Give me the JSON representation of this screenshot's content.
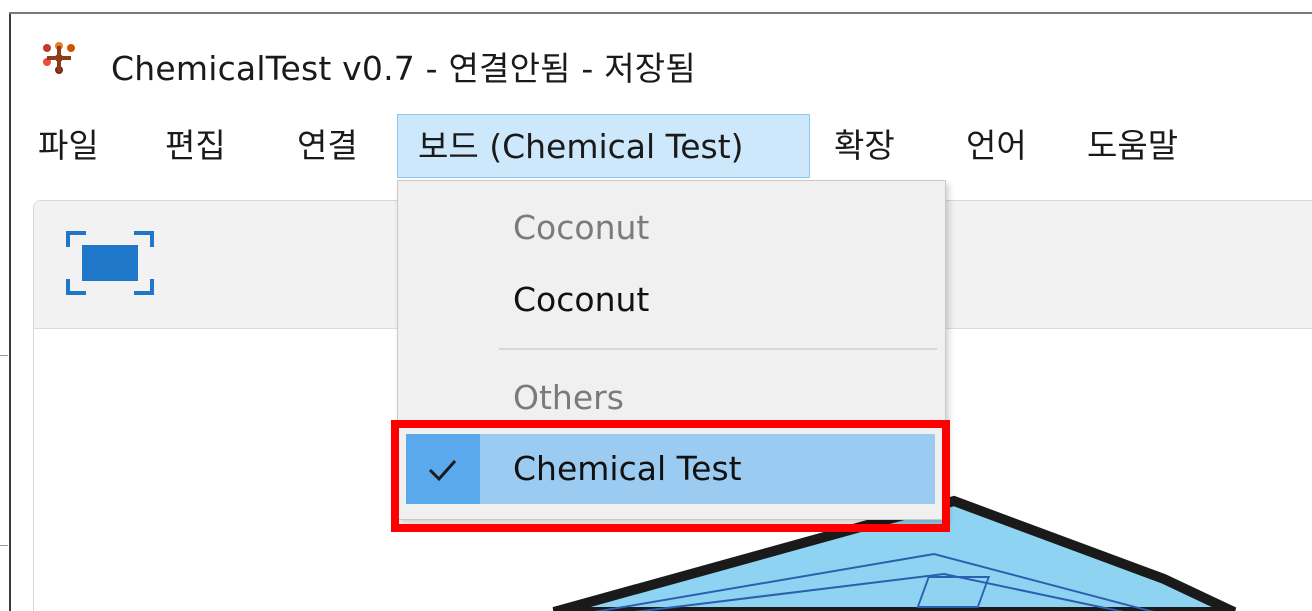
{
  "window": {
    "title": "ChemicalTest v0.7 - 연결안됨 - 저장됨"
  },
  "menu": {
    "items": [
      {
        "id": "file",
        "label": "파일"
      },
      {
        "id": "edit",
        "label": "편집"
      },
      {
        "id": "connect",
        "label": "연결"
      },
      {
        "id": "board",
        "label": "보드 (Chemical Test)",
        "active": true
      },
      {
        "id": "extensions",
        "label": "확장"
      },
      {
        "id": "language",
        "label": "언어"
      },
      {
        "id": "help",
        "label": "도움말"
      }
    ]
  },
  "board_menu": {
    "sections": [
      {
        "header": "Coconut",
        "options": [
          {
            "label": "Coconut",
            "checked": false
          }
        ]
      },
      {
        "header": "Others",
        "options": [
          {
            "label": "Chemical Test",
            "checked": true
          }
        ]
      }
    ],
    "check_mark": "✓"
  },
  "colors": {
    "menu_active_bg": "#cde8fb",
    "selected_bg": "#9ccbf1",
    "check_bg": "#5aa9ec",
    "highlight": "#ff0000",
    "board_fill": "#8fd3f2"
  },
  "icons": {
    "app": "app-logo-icon",
    "fullscreen": "fullscreen-icon",
    "check": "checkmark-icon"
  }
}
